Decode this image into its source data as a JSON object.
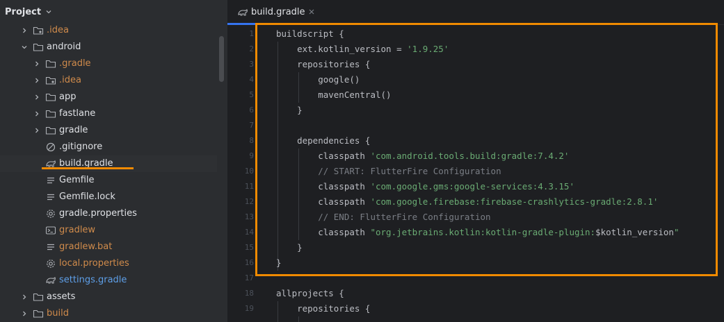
{
  "sidebar": {
    "title": "Project",
    "tree": [
      {
        "label": ".idea",
        "icon": "folder-dotted-icon",
        "depth": 1,
        "expandable": true,
        "expanded": false,
        "color": "orange"
      },
      {
        "label": "android",
        "icon": "folder-icon",
        "depth": 1,
        "expandable": true,
        "expanded": true,
        "color": "default"
      },
      {
        "label": ".gradle",
        "icon": "folder-icon",
        "depth": 2,
        "expandable": true,
        "expanded": false,
        "color": "orange"
      },
      {
        "label": ".idea",
        "icon": "folder-dotted-icon",
        "depth": 2,
        "expandable": true,
        "expanded": false,
        "color": "orange"
      },
      {
        "label": "app",
        "icon": "folder-icon",
        "depth": 2,
        "expandable": true,
        "expanded": false,
        "color": "default"
      },
      {
        "label": "fastlane",
        "icon": "folder-icon",
        "depth": 2,
        "expandable": true,
        "expanded": false,
        "color": "default"
      },
      {
        "label": "gradle",
        "icon": "folder-icon",
        "depth": 2,
        "expandable": true,
        "expanded": false,
        "color": "default"
      },
      {
        "label": ".gitignore",
        "icon": "ignore-icon",
        "depth": 2,
        "expandable": false,
        "color": "default"
      },
      {
        "label": "build.gradle",
        "icon": "gradle-elephant-icon",
        "depth": 2,
        "expandable": false,
        "color": "default",
        "selected": true
      },
      {
        "label": "Gemfile",
        "icon": "text-file-icon",
        "depth": 2,
        "expandable": false,
        "color": "default"
      },
      {
        "label": "Gemfile.lock",
        "icon": "text-file-icon",
        "depth": 2,
        "expandable": false,
        "color": "default"
      },
      {
        "label": "gradle.properties",
        "icon": "settings-gear-icon",
        "depth": 2,
        "expandable": false,
        "color": "default"
      },
      {
        "label": "gradlew",
        "icon": "terminal-icon",
        "depth": 2,
        "expandable": false,
        "color": "orange"
      },
      {
        "label": "gradlew.bat",
        "icon": "text-file-icon",
        "depth": 2,
        "expandable": false,
        "color": "orange"
      },
      {
        "label": "local.properties",
        "icon": "settings-gear-icon",
        "depth": 2,
        "expandable": false,
        "color": "orange"
      },
      {
        "label": "settings.gradle",
        "icon": "gradle-elephant-icon",
        "depth": 2,
        "expandable": false,
        "color": "blue"
      },
      {
        "label": "assets",
        "icon": "folder-icon",
        "depth": 1,
        "expandable": true,
        "expanded": false,
        "color": "default"
      },
      {
        "label": "build",
        "icon": "folder-icon",
        "depth": 1,
        "expandable": true,
        "expanded": false,
        "color": "orange"
      }
    ]
  },
  "editor": {
    "tab": {
      "label": "build.gradle",
      "icon": "gradle-elephant-icon"
    },
    "line_numbers": [
      "1",
      "2",
      "3",
      "4",
      "5",
      "6",
      "7",
      "8",
      "9",
      "10",
      "11",
      "12",
      "13",
      "14",
      "15",
      "16",
      "17",
      "18",
      "19"
    ],
    "lines": [
      [
        {
          "t": "buildscript {",
          "c": "plain"
        }
      ],
      [
        {
          "t": "    ext.kotlin_version = ",
          "c": "plain"
        },
        {
          "t": "'1.9.25'",
          "c": "str"
        }
      ],
      [
        {
          "t": "    repositories {",
          "c": "plain"
        }
      ],
      [
        {
          "t": "        google()",
          "c": "plain"
        }
      ],
      [
        {
          "t": "        mavenCentral()",
          "c": "plain"
        }
      ],
      [
        {
          "t": "    }",
          "c": "plain"
        }
      ],
      [
        {
          "t": "",
          "c": "plain"
        }
      ],
      [
        {
          "t": "    dependencies {",
          "c": "plain"
        }
      ],
      [
        {
          "t": "        classpath ",
          "c": "plain"
        },
        {
          "t": "'com.android.tools.build:gradle:7.4.2'",
          "c": "str"
        }
      ],
      [
        {
          "t": "        // START: FlutterFire Configuration",
          "c": "cmt"
        }
      ],
      [
        {
          "t": "        classpath ",
          "c": "plain"
        },
        {
          "t": "'com.google.gms:google-services:4.3.15'",
          "c": "str"
        }
      ],
      [
        {
          "t": "        classpath ",
          "c": "plain"
        },
        {
          "t": "'com.google.firebase:firebase-crashlytics-gradle:2.8.1'",
          "c": "str"
        }
      ],
      [
        {
          "t": "        // END: FlutterFire Configuration",
          "c": "cmt"
        }
      ],
      [
        {
          "t": "        classpath ",
          "c": "plain"
        },
        {
          "t": "\"org.jetbrains.kotlin:kotlin-gradle-plugin:",
          "c": "str"
        },
        {
          "t": "$kotlin_version",
          "c": "plain"
        },
        {
          "t": "\"",
          "c": "str"
        }
      ],
      [
        {
          "t": "    }",
          "c": "plain"
        }
      ],
      [
        {
          "t": "}",
          "c": "plain"
        }
      ],
      [
        {
          "t": "",
          "c": "plain"
        }
      ],
      [
        {
          "t": "allprojects {",
          "c": "plain"
        }
      ],
      [
        {
          "t": "    repositories {",
          "c": "plain"
        }
      ]
    ]
  },
  "colors": {
    "highlight": "#f08a00",
    "tab_active": "#3574f0",
    "string": "#6aab73",
    "comment": "#7a7e85"
  }
}
